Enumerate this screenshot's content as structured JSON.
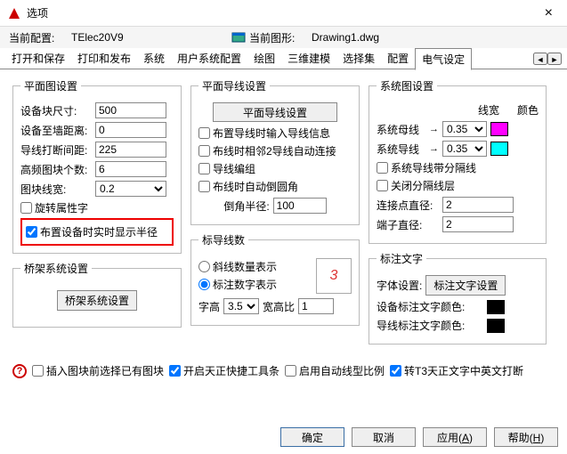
{
  "window": {
    "title": "选项"
  },
  "info": {
    "profile_label": "当前配置:",
    "profile_value": "TElec20V9",
    "drawing_label": "当前图形:",
    "drawing_value": "Drawing1.dwg"
  },
  "tabs": {
    "items": [
      "打开和保存",
      "打印和发布",
      "系统",
      "用户系统配置",
      "绘图",
      "三维建模",
      "选择集",
      "配置",
      "电气设定"
    ],
    "active": "电气设定"
  },
  "plan_set": {
    "legend": "平面图设置",
    "block_size_lbl": "设备块尺寸:",
    "block_size": "500",
    "wall_dist_lbl": "设备至墙距离:",
    "wall_dist": "0",
    "break_dist_lbl": "导线打断间距:",
    "break_dist": "225",
    "hf_block_lbl": "高频图块个数:",
    "hf_block": "6",
    "line_w_lbl": "图块线宽:",
    "line_w": "0.2",
    "rot_attr": "旋转属性字",
    "realtime_radius": "布置设备时实时显示半径"
  },
  "bridge": {
    "legend": "桥架系统设置",
    "btn": "桥架系统设置"
  },
  "wire_set": {
    "legend": "平面导线设置",
    "btn": "平面导线设置",
    "input_info": "布置导线时输入导线信息",
    "two_wire": "布线时相邻2导线自动连接",
    "wire_edit": "导线编组",
    "auto_fillet": "布线时自动倒圆角",
    "fillet_r_lbl": "倒角半径:",
    "fillet_r": "100"
  },
  "leader": {
    "legend": "标导线数",
    "opt_slash": "斜线数量表示",
    "opt_digit": "标注数字表示",
    "sample": "3",
    "char_h_lbl": "字高",
    "char_h": "3.5",
    "wh_lbl": "宽高比",
    "wh": "1"
  },
  "sys_set": {
    "legend": "系统图设置",
    "linew_lbl": "线宽",
    "color_lbl": "颜色",
    "bus_lbl": "系统母线",
    "bus_w": "0.35",
    "wire_lbl": "系统导线",
    "wire_w": "0.35",
    "sep_line": "系统导线带分隔线",
    "close_sep": "关闭分隔线层",
    "conn_d_lbl": "连接点直径:",
    "conn_d": "2",
    "term_d_lbl": "端子直径:",
    "term_d": "2"
  },
  "anno": {
    "legend": "标注文字",
    "font_set_lbl": "字体设置:",
    "font_btn": "标注文字设置",
    "dev_color_lbl": "设备标注文字颜色:",
    "wire_color_lbl": "导线标注文字颜色:"
  },
  "bottom": {
    "pre_select": "插入图块前选择已有图块",
    "enable_tz": "开启天正快捷工具条",
    "auto_ltype": "启用自动线型比例",
    "convert_t3": "转T3天正文字中英文打断"
  },
  "footer": {
    "ok": "确定",
    "cancel": "取消",
    "apply": "应用(",
    "apply_a": "A",
    "apply_end": ")",
    "help": "帮助(",
    "help_h": "H",
    "help_end": ")"
  }
}
